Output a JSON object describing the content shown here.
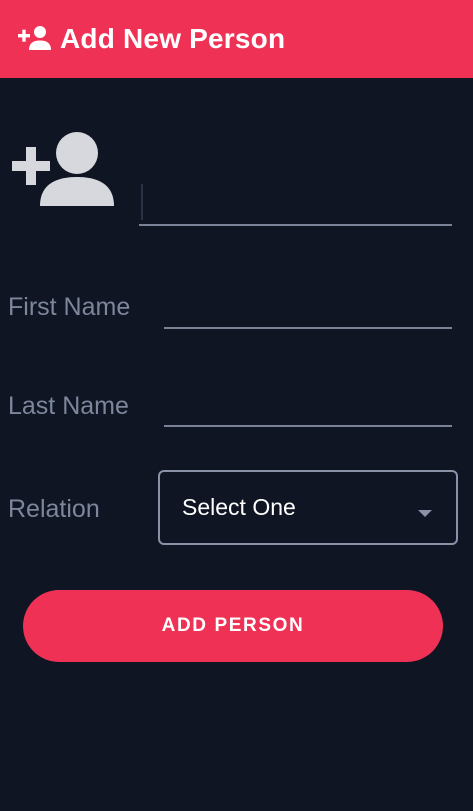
{
  "header": {
    "icon": "person-add-icon",
    "title": "Add New Person"
  },
  "photo": {
    "icon": "person-add-icon",
    "value": ""
  },
  "form": {
    "first_name_label": "First Name",
    "first_name_value": "",
    "last_name_label": "Last Name",
    "last_name_value": "",
    "relation_label": "Relation",
    "relation_selected": "Select One"
  },
  "actions": {
    "add_label": "ADD PERSON"
  },
  "colors": {
    "accent": "#ef3155",
    "background": "#0f1523",
    "label": "#7d869b",
    "underline": "#7a8296",
    "icon": "#d6d8de"
  }
}
